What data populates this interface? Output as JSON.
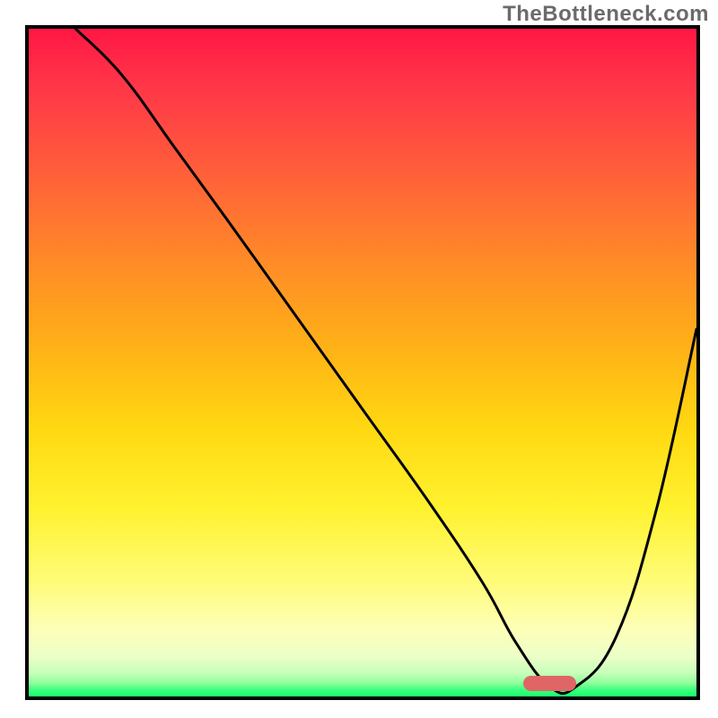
{
  "watermark": "TheBottleneck.com",
  "chart_data": {
    "type": "line",
    "title": "",
    "xlabel": "",
    "ylabel": "",
    "xlim": [
      0,
      100
    ],
    "ylim": [
      0,
      100
    ],
    "grid": false,
    "background_gradient": [
      {
        "pos": 0,
        "color": "#ff1744"
      },
      {
        "pos": 8,
        "color": "#ff3448"
      },
      {
        "pos": 20,
        "color": "#ff5a3c"
      },
      {
        "pos": 35,
        "color": "#ff8b27"
      },
      {
        "pos": 48,
        "color": "#ffb217"
      },
      {
        "pos": 60,
        "color": "#ffd911"
      },
      {
        "pos": 72,
        "color": "#fff230"
      },
      {
        "pos": 83,
        "color": "#fffc7a"
      },
      {
        "pos": 90,
        "color": "#fdffb8"
      },
      {
        "pos": 94,
        "color": "#ecffc8"
      },
      {
        "pos": 96.5,
        "color": "#c7ffb9"
      },
      {
        "pos": 98,
        "color": "#8dff9c"
      },
      {
        "pos": 99,
        "color": "#3cff7c"
      },
      {
        "pos": 100,
        "color": "#1aff6c"
      }
    ],
    "series": [
      {
        "name": "curve",
        "x": [
          7,
          14,
          22,
          30,
          40,
          50,
          60,
          68,
          73,
          78,
          82,
          88,
          94,
          100
        ],
        "y": [
          100,
          93,
          82,
          71,
          57,
          43,
          29,
          17,
          8,
          1.5,
          1.5,
          9,
          28,
          55
        ]
      }
    ],
    "marker": {
      "x_center": 78,
      "y": 2,
      "width": 8,
      "height": 2.3,
      "color": "#e06666"
    }
  }
}
